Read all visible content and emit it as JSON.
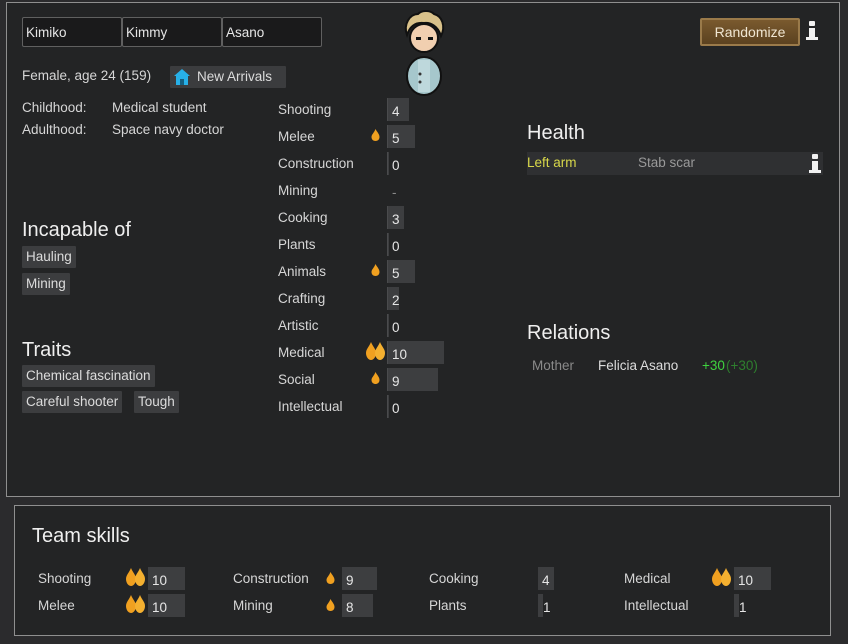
{
  "name": {
    "first": "Kimiko",
    "nick": "Kimmy",
    "last": "Asano"
  },
  "buttons": {
    "randomize": "Randomize"
  },
  "bio": {
    "summary": "Female, age 24 (159)",
    "faction": "New Arrivals",
    "childhood_label": "Childhood:",
    "childhood": "Medical student",
    "adulthood_label": "Adulthood:",
    "adulthood": "Space navy doctor"
  },
  "incapable": {
    "title": "Incapable of",
    "items": [
      "Hauling",
      "Mining"
    ]
  },
  "traits": {
    "title": "Traits",
    "items": [
      "Chemical fascination",
      "Careful shooter",
      "Tough"
    ]
  },
  "skills": [
    {
      "name": "Shooting",
      "level": "4",
      "passion": "none"
    },
    {
      "name": "Melee",
      "level": "5",
      "passion": "minor"
    },
    {
      "name": "Construction",
      "level": "0",
      "passion": "none"
    },
    {
      "name": "Mining",
      "level": "-",
      "passion": "none"
    },
    {
      "name": "Cooking",
      "level": "3",
      "passion": "none"
    },
    {
      "name": "Plants",
      "level": "0",
      "passion": "none"
    },
    {
      "name": "Animals",
      "level": "5",
      "passion": "minor"
    },
    {
      "name": "Crafting",
      "level": "2",
      "passion": "none"
    },
    {
      "name": "Artistic",
      "level": "0",
      "passion": "none"
    },
    {
      "name": "Medical",
      "level": "10",
      "passion": "major"
    },
    {
      "name": "Social",
      "level": "9",
      "passion": "minor"
    },
    {
      "name": "Intellectual",
      "level": "0",
      "passion": "none"
    }
  ],
  "health": {
    "title": "Health",
    "part": "Left arm",
    "condition": "Stab scar"
  },
  "relations": {
    "title": "Relations",
    "relation": "Mother",
    "person": "Felicia Asano",
    "opinion": "+30",
    "opinion_paren": "(+30)"
  },
  "team": {
    "title": "Team skills",
    "skills": [
      {
        "name": "Shooting",
        "level": "10",
        "passion": "major"
      },
      {
        "name": "Melee",
        "level": "10",
        "passion": "major"
      },
      {
        "name": "Construction",
        "level": "9",
        "passion": "minor"
      },
      {
        "name": "Mining",
        "level": "8",
        "passion": "minor"
      },
      {
        "name": "Cooking",
        "level": "4",
        "passion": "none"
      },
      {
        "name": "Plants",
        "level": "1",
        "passion": "none"
      },
      {
        "name": "Medical",
        "level": "10",
        "passion": "major"
      },
      {
        "name": "Intellectual",
        "level": "1",
        "passion": "none"
      }
    ]
  },
  "colors": {
    "accent_button": "#6b4e27",
    "health_part": "#d8d84a",
    "opinion_positive": "#3fd33f",
    "opinion_paren": "#2e7f2e",
    "passion_flame": "#f0a020"
  }
}
